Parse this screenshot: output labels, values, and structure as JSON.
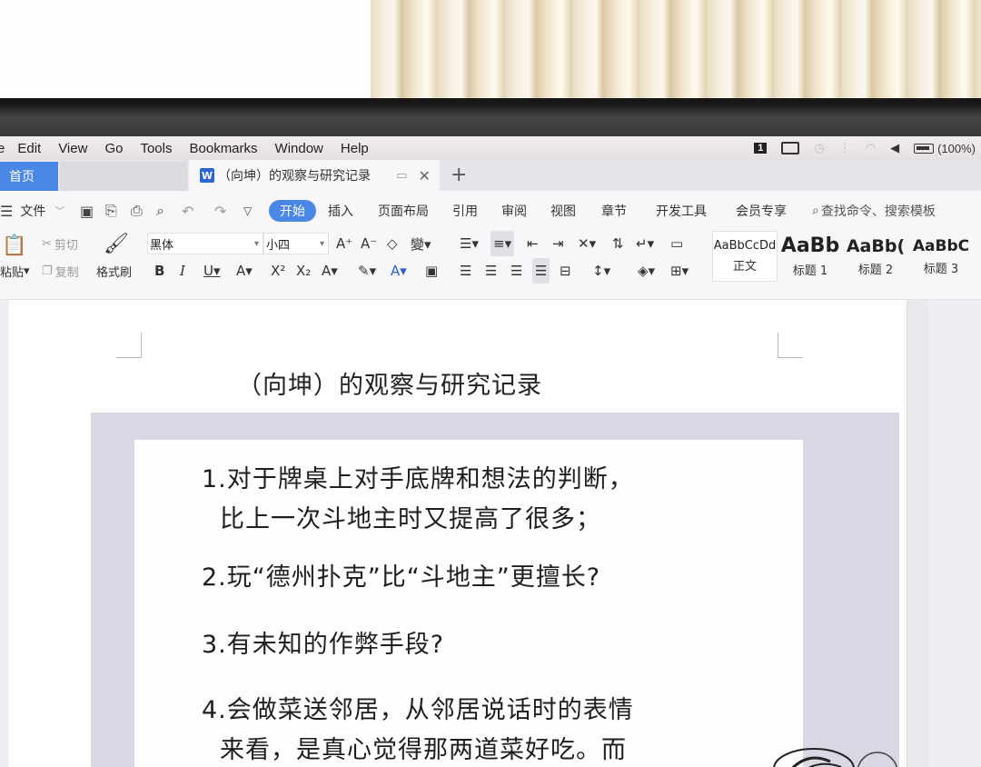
{
  "menubar": {
    "items": [
      "e",
      "Edit",
      "View",
      "Go",
      "Tools",
      "Bookmarks",
      "Window",
      "Help"
    ],
    "status_badge": "1",
    "battery_text": "(100%)"
  },
  "tabs": {
    "home": "首页",
    "doc_title": "（向坤）的观察与研究记录",
    "doc_icon": "W"
  },
  "ribbon_menu": {
    "file": "文件",
    "items": [
      "开始",
      "插入",
      "页面布局",
      "引用",
      "审阅",
      "视图",
      "章节",
      "开发工具",
      "会员专享"
    ],
    "search": "查找命令、搜索模板"
  },
  "toolbar": {
    "cut": "剪切",
    "copy": "复制",
    "paste": "粘贴",
    "format_painter": "格式刷",
    "font_name": "黑体",
    "font_size": "小四"
  },
  "styles": [
    {
      "sample": "AaBbCcDd",
      "name": "正文"
    },
    {
      "sample": "AaBb",
      "name": "标题 1"
    },
    {
      "sample": "AaBb(",
      "name": "标题 2"
    },
    {
      "sample": "AaBbC",
      "name": "标题 3"
    }
  ],
  "document": {
    "title": "（向坤）的观察与研究记录",
    "notes": [
      {
        "line1": "1.对于牌桌上对手底牌和想法的判断，",
        "line2": "比上一次斗地主时又提高了很多；"
      },
      {
        "line1": "2.玩“德州扑克”比“斗地主”更擅长?",
        "line2": ""
      },
      {
        "line1": "3.有未知的作弊手段?",
        "line2": ""
      },
      {
        "line1": "4.会做菜送邻居，从邻居说话时的表情",
        "line2": "来看，是真心觉得那两道菜好吃。而"
      }
    ]
  },
  "colors": {
    "accent": "#4a87e6",
    "panel": "#d8d8e4"
  }
}
